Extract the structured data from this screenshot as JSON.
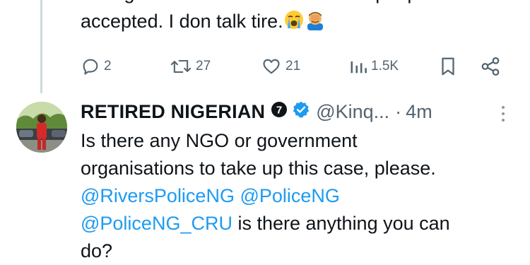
{
  "prev_tweet": {
    "line1": "to forget about the case and these people",
    "line2": "accepted. I don talk tire.",
    "emojis": [
      "loudly-crying-face",
      "face-palm"
    ],
    "actions": {
      "replies": "2",
      "reposts": "27",
      "likes": "21",
      "views": "1.5K"
    }
  },
  "reply_tweet": {
    "author_name": "RETIRED NIGERIAN",
    "badge_number": "7",
    "handle": "@Kinq...",
    "separator": "·",
    "time": "4m",
    "text": {
      "line1": "Is there any NGO or government",
      "line2": "organisations to take up this case, please.",
      "mention1": "@RiversPoliceNG",
      "mention2": "@PoliceNG",
      "mention3": "@PoliceNG_CRU",
      "line4_rest": " is there anything you can",
      "line5": "do?"
    }
  },
  "colors": {
    "text": "#0f1419",
    "muted": "#536471",
    "link": "#1d9bf0",
    "verified": "#1d9bf0"
  }
}
